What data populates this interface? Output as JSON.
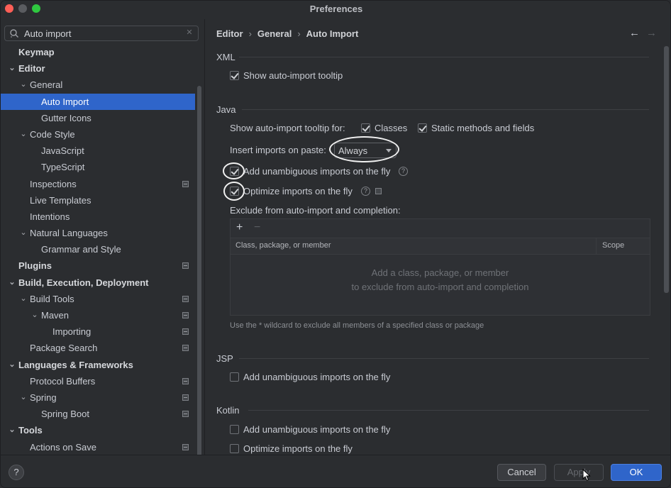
{
  "window": {
    "title": "Preferences"
  },
  "search": {
    "value": "Auto import",
    "icon": "search-icon"
  },
  "sidebar": {
    "items": [
      {
        "label": "Keymap",
        "level": 0,
        "bold": true,
        "arrow": "",
        "mark": false
      },
      {
        "label": "Editor",
        "level": 0,
        "bold": true,
        "arrow": "v",
        "mark": false
      },
      {
        "label": "General",
        "level": 1,
        "bold": false,
        "arrow": "v",
        "mark": false
      },
      {
        "label": "Auto Import",
        "level": 2,
        "bold": false,
        "arrow": "",
        "mark": false,
        "selected": true
      },
      {
        "label": "Gutter Icons",
        "level": 2,
        "bold": false,
        "arrow": "",
        "mark": false
      },
      {
        "label": "Code Style",
        "level": 1,
        "bold": false,
        "arrow": "v",
        "mark": false
      },
      {
        "label": "JavaScript",
        "level": 2,
        "bold": false,
        "arrow": "",
        "mark": false
      },
      {
        "label": "TypeScript",
        "level": 2,
        "bold": false,
        "arrow": "",
        "mark": false
      },
      {
        "label": "Inspections",
        "level": 1,
        "bold": false,
        "arrow": "",
        "mark": true
      },
      {
        "label": "Live Templates",
        "level": 1,
        "bold": false,
        "arrow": "",
        "mark": false
      },
      {
        "label": "Intentions",
        "level": 1,
        "bold": false,
        "arrow": "",
        "mark": false
      },
      {
        "label": "Natural Languages",
        "level": 1,
        "bold": false,
        "arrow": "v",
        "mark": false
      },
      {
        "label": "Grammar and Style",
        "level": 2,
        "bold": false,
        "arrow": "",
        "mark": false
      },
      {
        "label": "Plugins",
        "level": 0,
        "bold": true,
        "arrow": "",
        "mark": true
      },
      {
        "label": "Build, Execution, Deployment",
        "level": 0,
        "bold": true,
        "arrow": "v",
        "mark": false
      },
      {
        "label": "Build Tools",
        "level": 1,
        "bold": false,
        "arrow": "v",
        "mark": true
      },
      {
        "label": "Maven",
        "level": 2,
        "bold": false,
        "arrow": "v",
        "mark": true
      },
      {
        "label": "Importing",
        "level": 3,
        "bold": false,
        "arrow": "",
        "mark": true
      },
      {
        "label": "Package Search",
        "level": 1,
        "bold": false,
        "arrow": "",
        "mark": true
      },
      {
        "label": "Languages & Frameworks",
        "level": 0,
        "bold": true,
        "arrow": "v",
        "mark": false
      },
      {
        "label": "Protocol Buffers",
        "level": 1,
        "bold": false,
        "arrow": "",
        "mark": true
      },
      {
        "label": "Spring",
        "level": 1,
        "bold": false,
        "arrow": "v",
        "mark": true
      },
      {
        "label": "Spring Boot",
        "level": 2,
        "bold": false,
        "arrow": "",
        "mark": true
      },
      {
        "label": "Tools",
        "level": 0,
        "bold": true,
        "arrow": "v",
        "mark": false
      },
      {
        "label": "Actions on Save",
        "level": 1,
        "bold": false,
        "arrow": "",
        "mark": true
      }
    ]
  },
  "breadcrumb": {
    "part1": "Editor",
    "part2": "General",
    "part3": "Auto Import"
  },
  "xml": {
    "title": "XML",
    "show_tooltip": {
      "label": "Show auto-import tooltip",
      "checked": true
    }
  },
  "java": {
    "title": "Java",
    "tooltip_for_label": "Show auto-import tooltip for:",
    "classes": {
      "label": "Classes",
      "checked": true
    },
    "static_methods": {
      "label": "Static methods and fields",
      "checked": true
    },
    "insert_on_paste_label": "Insert imports on paste:",
    "insert_on_paste_value": "Always",
    "add_unambiguous": {
      "label": "Add unambiguous imports on the fly",
      "checked": true
    },
    "optimize_imports": {
      "label": "Optimize imports on the fly",
      "checked": true
    },
    "exclude_label": "Exclude from auto-import and completion:",
    "table": {
      "col1": "Class, package, or member",
      "col2": "Scope",
      "empty_line1": "Add a class, package, or member",
      "empty_line2": "to exclude from auto-import and completion"
    },
    "hint": "Use the * wildcard to exclude all members of a specified class or package"
  },
  "jsp": {
    "title": "JSP",
    "add_unambiguous": {
      "label": "Add unambiguous imports on the fly",
      "checked": false
    }
  },
  "kotlin": {
    "title": "Kotlin",
    "add_unambiguous": {
      "label": "Add unambiguous imports on the fly",
      "checked": false
    },
    "optimize_imports": {
      "label": "Optimize imports on the fly",
      "checked": false
    }
  },
  "buttons": {
    "cancel": "Cancel",
    "apply": "Apply",
    "ok": "OK",
    "help": "?"
  },
  "colors": {
    "accent": "#2f65ca",
    "background": "#2b2d30",
    "text": "#c9ccd3"
  }
}
